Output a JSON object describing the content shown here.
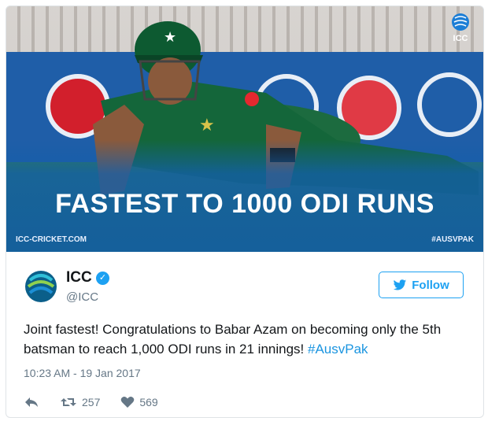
{
  "media": {
    "headline": "FASTEST TO 1000 ODI RUNS",
    "site_label": "ICC-CRICKET.COM",
    "hashtag_label": "#AUSVPAK",
    "badge_text": "ICC"
  },
  "tweet": {
    "name": "ICC",
    "handle": "@ICC",
    "follow_label": "Follow",
    "text": "Joint fastest! Congratulations to Babar Azam on becoming only the 5th batsman to reach 1,000 ODI runs in 21 innings!",
    "hashtag": "#AusvPak",
    "timestamp": "10:23 AM - 19 Jan 2017",
    "retweets": "257",
    "likes": "569"
  },
  "colors": {
    "accent": "#1da1f2",
    "media_blue": "#1f5ea8"
  },
  "icons": {
    "reply": "reply-icon",
    "retweet": "retweet-icon",
    "like": "heart-icon",
    "verified": "verified-badge-icon",
    "bird": "twitter-bird-icon"
  }
}
